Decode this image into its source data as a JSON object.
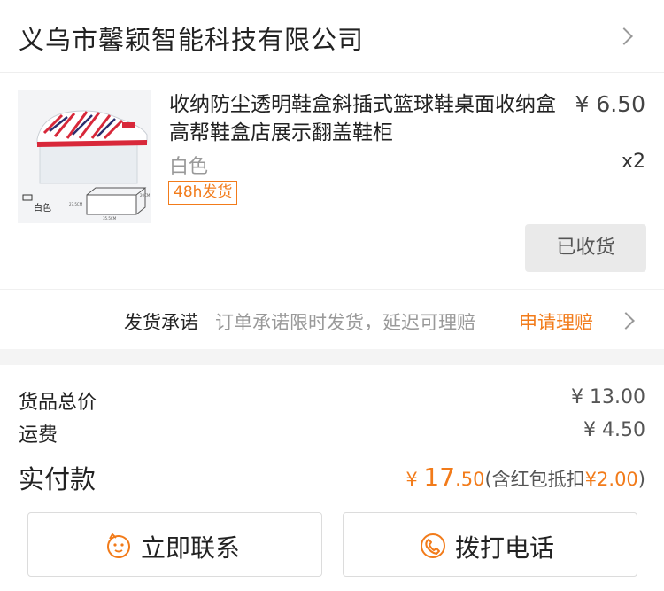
{
  "shop": {
    "name": "义乌市馨颖智能科技有限公司"
  },
  "product": {
    "title": "收纳防尘透明鞋盒斜插式篮球鞋桌面收纳盒高帮鞋盒店展示翻盖鞋柜",
    "price": "¥ 6.50",
    "spec": "白色",
    "quantity": "x2",
    "badge": "48h发货",
    "status_button": "已收货",
    "image_text": {
      "logo": "白色",
      "dim_height": "27.5CM",
      "dim_width": "35.5CM",
      "dim_depth": "20CM"
    }
  },
  "promise": {
    "label": "发货承诺",
    "text": "订单承诺限时发货，延迟可理赔",
    "link": "申请理赔"
  },
  "summary": {
    "goods_total_label": "货品总价",
    "goods_total_value": "¥ 13.00",
    "shipping_label": "运费",
    "shipping_value": "¥ 4.50",
    "paid_label": "实付款",
    "paid_currency": "¥ ",
    "paid_int": "17",
    "paid_dec": ".50",
    "paid_note_open": "(含红包抵扣",
    "paid_discount": "¥2.00",
    "paid_note_close": ")"
  },
  "actions": {
    "contact_label": "立即联系",
    "call_label": "拨打电话"
  },
  "colors": {
    "accent": "#f27b1a",
    "divider": "#f4f4f4"
  },
  "icons": {
    "shop_chevron": "chevron-right-icon",
    "promise_chevron": "chevron-right-icon",
    "contact": "chat-bubble-icon",
    "call": "phone-icon"
  }
}
